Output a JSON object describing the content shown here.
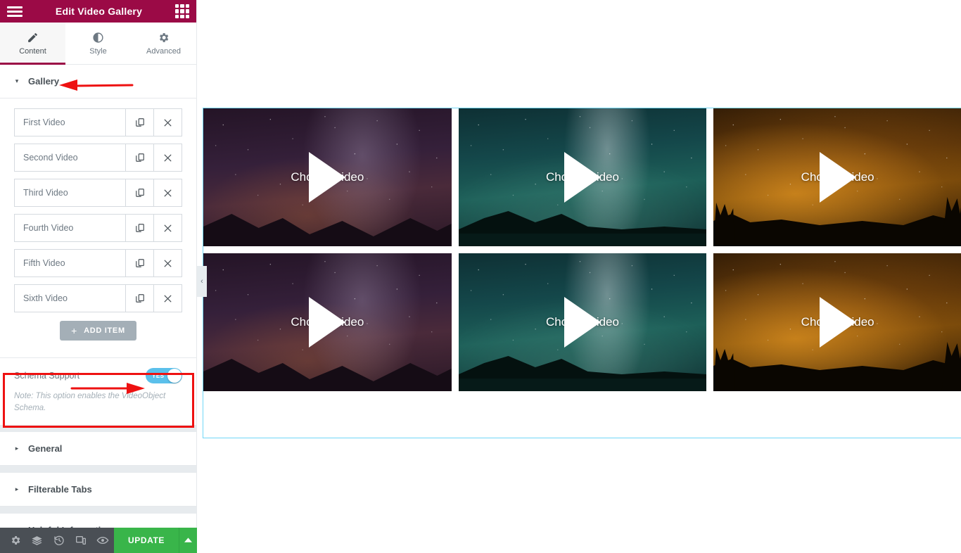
{
  "panel": {
    "header": {
      "title": "Edit Video Gallery",
      "menu_icon": "hamburger-icon",
      "apps_icon": "apps-grid-icon"
    },
    "tabs": [
      {
        "label": "Content",
        "icon": "pencil-icon",
        "active": true
      },
      {
        "label": "Style",
        "icon": "contrast-icon",
        "active": false
      },
      {
        "label": "Advanced",
        "icon": "gear-icon",
        "active": false
      }
    ],
    "sections": [
      {
        "label": "Gallery",
        "expanded": true,
        "caret": "▾"
      },
      {
        "label": "General",
        "expanded": false,
        "caret": "▸"
      },
      {
        "label": "Filterable Tabs",
        "expanded": false,
        "caret": "▸"
      },
      {
        "label": "Helpful Information",
        "expanded": false,
        "caret": "▸"
      }
    ],
    "gallery": {
      "items": [
        {
          "title": "First Video",
          "duplicate_icon": "copy-icon",
          "remove_icon": "close-icon"
        },
        {
          "title": "Second Video",
          "duplicate_icon": "copy-icon",
          "remove_icon": "close-icon"
        },
        {
          "title": "Third Video",
          "duplicate_icon": "copy-icon",
          "remove_icon": "close-icon"
        },
        {
          "title": "Fourth Video",
          "duplicate_icon": "copy-icon",
          "remove_icon": "close-icon"
        },
        {
          "title": "Fifth Video",
          "duplicate_icon": "copy-icon",
          "remove_icon": "close-icon"
        },
        {
          "title": "Sixth Video",
          "duplicate_icon": "copy-icon",
          "remove_icon": "close-icon"
        }
      ],
      "add_item_label": "ADD ITEM",
      "add_item_plus": "+"
    },
    "schema_support": {
      "label": "Schema Support",
      "toggle_value": "YES",
      "toggle_on": true,
      "note": "Note: This option enables the VideoObject Schema."
    },
    "footer": {
      "icons": [
        {
          "name": "settings-gear-icon"
        },
        {
          "name": "navigator-layers-icon"
        },
        {
          "name": "history-clock-icon"
        },
        {
          "name": "responsive-mode-icon"
        },
        {
          "name": "preview-eye-icon"
        }
      ],
      "update_label": "UPDATE",
      "update_caret": "▲"
    }
  },
  "canvas": {
    "collapse_handle": "‹",
    "videos": [
      {
        "caption": "Choose video",
        "theme": "sky-a"
      },
      {
        "caption": "Choose video",
        "theme": "sky-b"
      },
      {
        "caption": "Choose video",
        "theme": "sky-c"
      },
      {
        "caption": "Choose video",
        "theme": "sky-a"
      },
      {
        "caption": "Choose video",
        "theme": "sky-b"
      },
      {
        "caption": "Choose video",
        "theme": "sky-c"
      }
    ]
  },
  "annotations": {
    "gallery_arrow": "red-arrow-pointing-left-at-gallery",
    "schema_arrow": "red-arrow-pointing-right-at-toggle",
    "schema_box": "red-highlight-rectangle"
  },
  "colors": {
    "brand": "#9b0a46",
    "accent_toggle": "#5bc0eb",
    "update_green": "#39b54a",
    "annotation_red": "#ee1111",
    "canvas_border": "#71d7f7",
    "footer_bg": "#4a4f55"
  }
}
